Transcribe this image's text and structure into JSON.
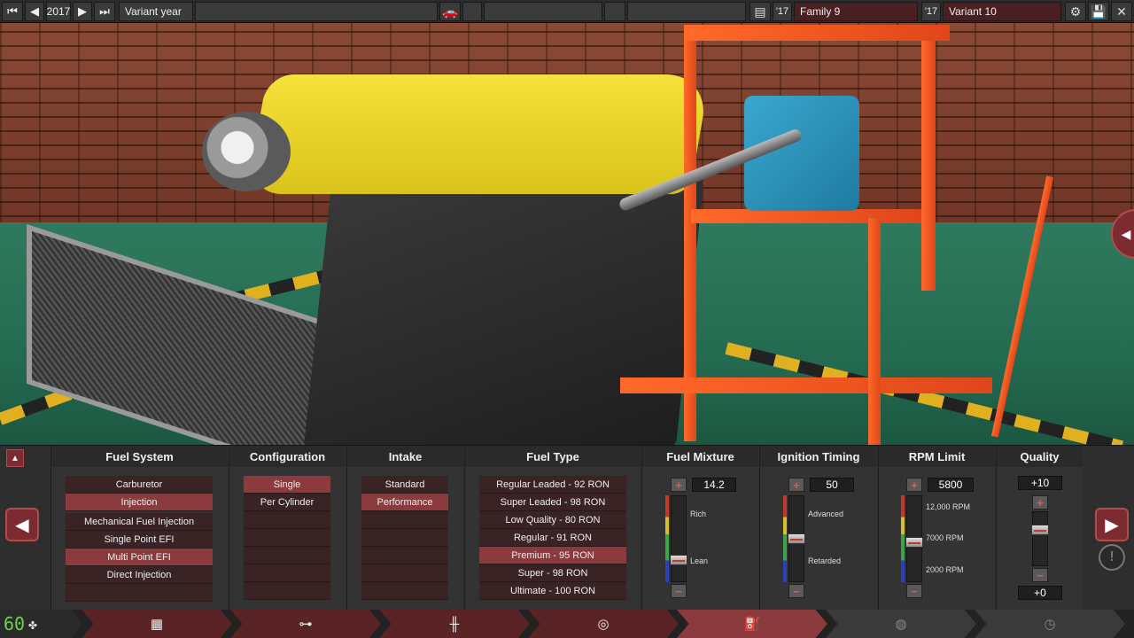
{
  "topbar": {
    "year": "2017",
    "variant_year_label": "Variant year",
    "family_year": "'17",
    "family_name": "Family 9",
    "variant_year_short": "'17",
    "variant_name": "Variant 10"
  },
  "columns": {
    "fuel_system": {
      "title": "Fuel System",
      "primary": [
        "Carburetor",
        "Injection"
      ],
      "primary_selected": "Injection",
      "secondary": [
        "Mechanical Fuel Injection",
        "Single Point EFI",
        "Multi Point EFI",
        "Direct Injection",
        ""
      ],
      "secondary_selected": "Multi Point EFI"
    },
    "configuration": {
      "title": "Configuration",
      "options": [
        "Single",
        "Per Cylinder",
        "",
        "",
        "",
        "",
        ""
      ],
      "selected": "Single"
    },
    "intake": {
      "title": "Intake",
      "options": [
        "Standard",
        "Performance",
        "",
        "",
        "",
        "",
        ""
      ],
      "selected": "Performance"
    },
    "fuel_type": {
      "title": "Fuel Type",
      "options": [
        "Regular Leaded - 92 RON",
        "Super Leaded - 98 RON",
        "Low Quality - 80 RON",
        "Regular - 91 RON",
        "Premium - 95 RON",
        "Super - 98 RON",
        "Ultimate - 100 RON"
      ],
      "selected": "Premium - 95 RON"
    },
    "fuel_mixture": {
      "title": "Fuel Mixture",
      "value": "14.2",
      "top_label": "Rich",
      "bottom_label": "Lean",
      "level": 0.22
    },
    "ignition_timing": {
      "title": "Ignition Timing",
      "value": "50",
      "top_label": "Advanced",
      "bottom_label": "Retarded",
      "level": 0.5
    },
    "rpm_limit": {
      "title": "RPM Limit",
      "value": "5800",
      "labels": [
        "12,000 RPM",
        "7000 RPM",
        "2000 RPM"
      ],
      "level": 0.45
    },
    "quality": {
      "title": "Quality",
      "max": "+10",
      "min": "+0",
      "level": 0.7
    }
  },
  "fps": "60",
  "nav": {
    "tabs": [
      "block-icon",
      "crank-icon",
      "head-icon",
      "turbo-icon",
      "fuel-icon",
      "exhaust-icon",
      "test-icon"
    ],
    "active": "fuel-icon"
  },
  "colors": {
    "accent": "#8b3a3d",
    "tab_active": "#8b3a3d",
    "tab_inactive": "#5a2326"
  }
}
